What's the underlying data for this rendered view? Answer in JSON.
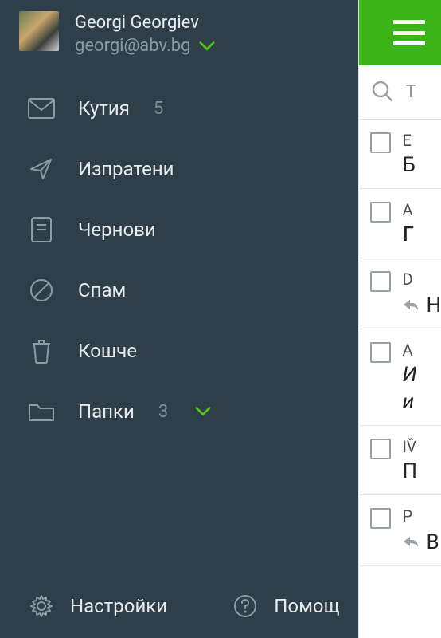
{
  "profile": {
    "name": "Georgi Georgiev",
    "email": "georgi@abv.bg"
  },
  "nav": {
    "inbox": {
      "label": "Кутия",
      "count": "5"
    },
    "sent": {
      "label": "Изпратени"
    },
    "drafts": {
      "label": "Чернови"
    },
    "spam": {
      "label": "Спам"
    },
    "trash": {
      "label": "Кошче"
    },
    "folders": {
      "label": "Папки",
      "count": "3"
    }
  },
  "footer": {
    "settings": "Настройки",
    "help": "Помощ"
  },
  "search": {
    "placeholder": "Т"
  },
  "mails": [
    {
      "sender": "E",
      "subject": "Б",
      "bold": false
    },
    {
      "sender": "A",
      "subject": "Г",
      "bold": true
    },
    {
      "sender": "D",
      "subject": "Н",
      "bold": false,
      "replied": true
    },
    {
      "sender": "A",
      "subject": "И",
      "subject2": "и",
      "bold": false,
      "italic": true
    },
    {
      "sender": "IѶ",
      "subject": "П",
      "bold": false
    },
    {
      "sender": "P",
      "subject": "В",
      "bold": false,
      "replied": true
    }
  ]
}
